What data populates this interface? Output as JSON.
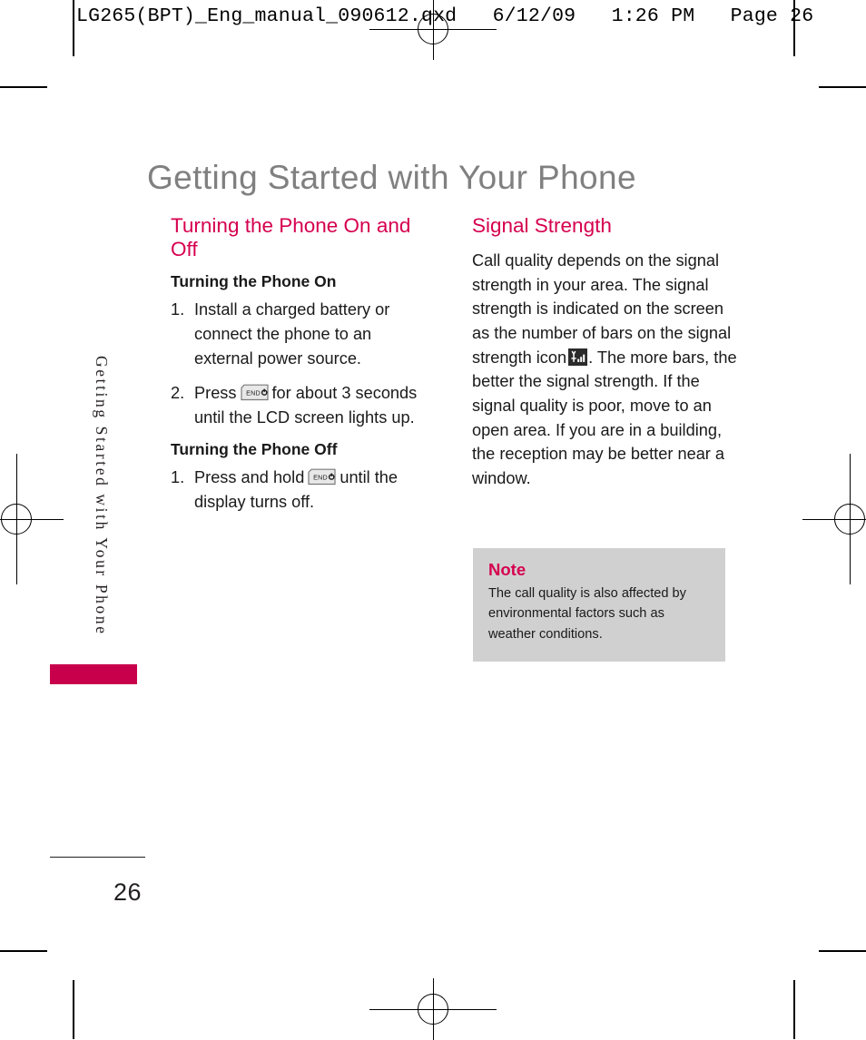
{
  "print_header": "LG265(BPT)_Eng_manual_090612.qxd   6/12/09   1:26 PM   Page 26",
  "page_title": "Getting Started with Your Phone",
  "side_tab": {
    "label": "Getting Started with Your Phone",
    "bar_color": "#c8004b"
  },
  "colors": {
    "accent": "#d6004f",
    "title_gray": "#808080",
    "note_bg": "#d0d0d0",
    "body": "#1a1a1a"
  },
  "left_column": {
    "section_heading": "Turning the Phone On and Off",
    "sub_heading_on": "Turning the Phone On",
    "steps_on": [
      {
        "num": "1.",
        "text_before": "Install a charged battery or connect the phone to an external power source.",
        "has_key_icon": false,
        "text_after": ""
      },
      {
        "num": "2.",
        "text_before": "Press",
        "has_key_icon": true,
        "key_label": "END",
        "text_after": "for about 3 seconds until the LCD screen lights up."
      }
    ],
    "sub_heading_off": "Turning the Phone Off",
    "steps_off": [
      {
        "num": "1.",
        "text_before": "Press and hold",
        "has_key_icon": true,
        "key_label": "END",
        "text_after": "until the display turns off."
      }
    ]
  },
  "right_column": {
    "section_heading": "Signal Strength",
    "body_part1": "Call quality depends on the signal strength in your area. The signal strength is indicated on the screen as the number of bars on the signal strength icon",
    "signal_icon_name": "signal-strength-icon",
    "body_part2": ". The more bars, the better the signal strength. If the signal quality is poor, move to an open area. If you are in a building, the reception may be better near a window."
  },
  "note": {
    "title": "Note",
    "text": "The call quality is also affected by environmental factors such as weather conditions."
  },
  "footer": {
    "page_number": "26"
  }
}
